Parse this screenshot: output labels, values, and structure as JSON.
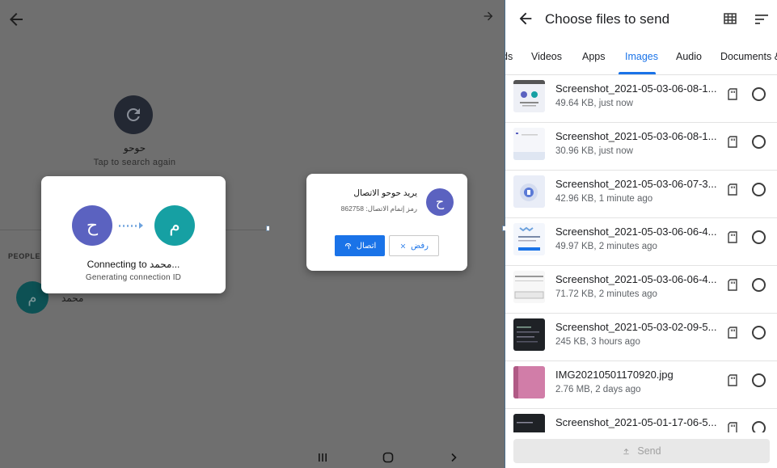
{
  "panel1": {
    "device_name": "حوحو",
    "tap_text": "Tap to search again",
    "people_header": "PEOPLE N",
    "person": {
      "initial": "م",
      "name": "محمد"
    },
    "dialog": {
      "left_initial": "ح",
      "right_initial": "م",
      "title": "Connecting to محمد...",
      "subtitle": "Generating connection ID"
    }
  },
  "panel2": {
    "dialog": {
      "initial": "ح",
      "title": "يريد حوحو الاتصال",
      "code_line": "رمز إتمام الاتصال: 862758",
      "accept_label": "اتصال",
      "decline_label": "رفض"
    }
  },
  "panel3": {
    "title": "Choose files to send",
    "tabs": [
      "ds",
      "Videos",
      "Apps",
      "Images",
      "Audio",
      "Documents &"
    ],
    "active_tab": "Images",
    "files": [
      {
        "name": "Screenshot_2021-05-03-06-08-1...",
        "meta": "49.64 KB, just now"
      },
      {
        "name": "Screenshot_2021-05-03-06-08-1...",
        "meta": "30.96 KB, just now"
      },
      {
        "name": "Screenshot_2021-05-03-06-07-3...",
        "meta": "42.96 KB, 1 minute ago"
      },
      {
        "name": "Screenshot_2021-05-03-06-06-4...",
        "meta": "49.97 KB, 2 minutes ago"
      },
      {
        "name": "Screenshot_2021-05-03-06-06-4...",
        "meta": "71.72 KB, 2 minutes ago"
      },
      {
        "name": "Screenshot_2021-05-03-02-09-5...",
        "meta": "245 KB, 3 hours ago"
      },
      {
        "name": "IMG20210501170920.jpg",
        "meta": "2.76 MB, 2 days ago"
      },
      {
        "name": "Screenshot_2021-05-01-17-06-5...",
        "meta": ""
      }
    ],
    "send_label": "Send"
  },
  "colors": {
    "accent": "#1a73e8",
    "avatar_purple": "#5b62c0",
    "avatar_teal": "#16a0a3",
    "scrim": "#6f6f6f"
  }
}
